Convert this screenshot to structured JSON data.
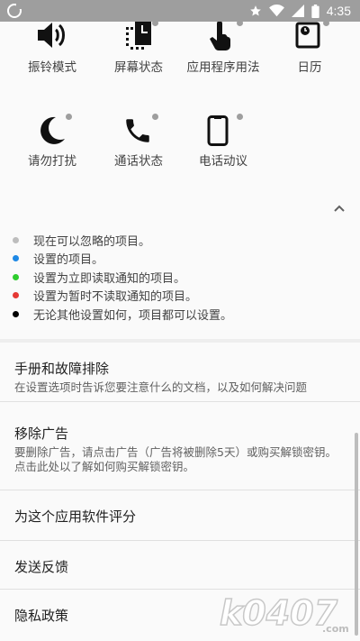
{
  "status_bar": {
    "time": "4:35",
    "icons": [
      "app-icon",
      "star-icon",
      "wifi-icon",
      "signal-icon",
      "battery-icon"
    ]
  },
  "tiles": [
    {
      "label": "振铃模式",
      "icon": "volume-icon"
    },
    {
      "label": "屏幕状态",
      "icon": "screen-state-icon"
    },
    {
      "label": "应用程序用法",
      "icon": "touch-icon"
    },
    {
      "label": "日历",
      "icon": "calendar-icon"
    },
    {
      "label": "请勿打扰",
      "icon": "moon-icon"
    },
    {
      "label": "通话状态",
      "icon": "phone-icon"
    },
    {
      "label": "电话动议",
      "icon": "smartphone-icon"
    }
  ],
  "legend": [
    {
      "color": "#bdbdbd",
      "text": "现在可以忽略的项目。"
    },
    {
      "color": "#1e88e5",
      "text": "设置的项目。"
    },
    {
      "color": "#2ecc2e",
      "text": "设置为立即读取通知的项目。"
    },
    {
      "color": "#e53935",
      "text": "设置为暂时不读取通知的项目。"
    },
    {
      "color": "#000000",
      "text": "无论其他设置如何，项目都可以设置。"
    }
  ],
  "menu": [
    {
      "title": "手册和故障排除",
      "subtitle": "在设置选项时告诉您要注意什么的文档，以及如何解决问题"
    },
    {
      "title": "移除广告",
      "subtitle": "要删除广告，请点击广告（广告将被删除5天）或购买解锁密钥。点击此处以了解如何购买解锁密钥。"
    },
    {
      "title": "为这个应用软件评分",
      "subtitle": ""
    },
    {
      "title": "发送反馈",
      "subtitle": ""
    },
    {
      "title": "隐私政策",
      "subtitle": ""
    }
  ],
  "watermark": {
    "text": "k0407",
    "suffix": ".com"
  }
}
